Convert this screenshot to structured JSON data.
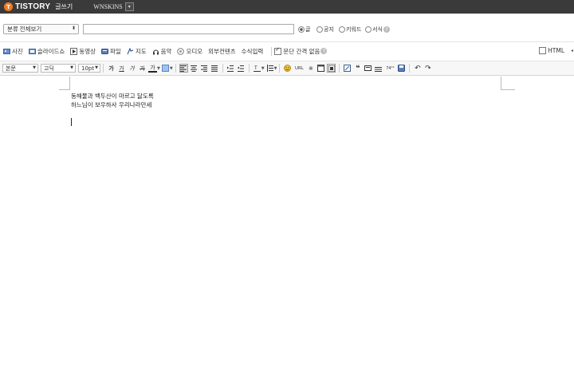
{
  "topbar": {
    "logo_letter": "T",
    "brand": "TISTORY",
    "page_label": "글쓰기",
    "blog_name": "WNSKINS",
    "blog_dropdown_glyph": "▾"
  },
  "post_header": {
    "category_select": "분류 전체보기",
    "title_value": "",
    "types": [
      {
        "label": "글",
        "selected": true
      },
      {
        "label": "공지",
        "selected": false
      },
      {
        "label": "키워드",
        "selected": false
      },
      {
        "label": "서식",
        "selected": false
      }
    ]
  },
  "attach_toolbar": {
    "items": [
      {
        "label": "사진",
        "icon": "photo-icon"
      },
      {
        "label": "슬라이드쇼",
        "icon": "slideshow-icon"
      },
      {
        "label": "동영상",
        "icon": "video-icon"
      },
      {
        "label": "파일",
        "icon": "file-icon"
      },
      {
        "label": "지도",
        "icon": "map-icon"
      },
      {
        "label": "음악",
        "icon": "music-icon"
      },
      {
        "label": "오디오",
        "icon": "audio-icon"
      },
      {
        "label": "외부컨텐츠",
        "icon": ""
      },
      {
        "label": "수식입력",
        "icon": ""
      }
    ],
    "no_paragraph_spacing": "문단 간격 없음",
    "html_label": "HTML"
  },
  "format_toolbar": {
    "paragraph_style": "본문",
    "font_family": "고딕",
    "font_size": "10pt",
    "bold": "가",
    "underline": "가",
    "italic": "가",
    "strike": "가",
    "font_color": "가",
    "url_label": "URL",
    "more_label": "74¹²"
  },
  "editor": {
    "lines": [
      "동해물과 백두산이 마르고 닳도록",
      "하느님이 보우하사 우리나라만세"
    ]
  },
  "colors": {
    "topbar_bg": "#3a3a3a",
    "brand_orange": "#f07a22"
  }
}
